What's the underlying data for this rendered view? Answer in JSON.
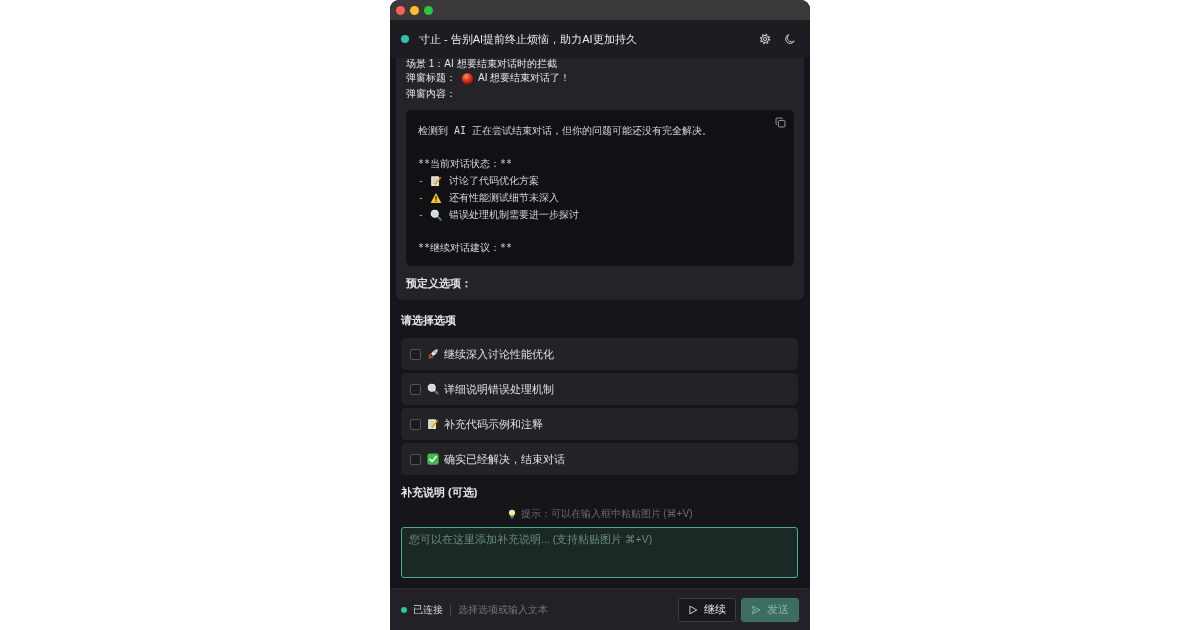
{
  "window": {
    "title": "寸止 - 告别AI提前终止烦恼，助力AI更加持久"
  },
  "popup": {
    "scene": "场景 1：AI 想要结束对话时的拦截",
    "title_label": "弹窗标题：",
    "title_value": "AI 想要结束对话了！",
    "content_label": "弹窗内容：",
    "content": {
      "paragraphs": [
        [
          {
            "kind": "plain",
            "text": "检测到 AI 正在尝试结束对话，但你的问题可能还没有完全解决。"
          }
        ],
        [
          {
            "kind": "plain",
            "text": "**当前对话状态：**"
          },
          {
            "kind": "note",
            "bullet": "-",
            "text": "讨论了代码优化方案"
          },
          {
            "kind": "warning",
            "bullet": "-",
            "text": "还有性能测试细节未深入"
          },
          {
            "kind": "search",
            "bullet": "-",
            "text": "错误处理机制需要进一步探讨"
          }
        ],
        [
          {
            "kind": "plain",
            "text": "**继续对话建议：**"
          }
        ]
      ]
    },
    "options_label": "预定义选项："
  },
  "options": {
    "heading": "请选择选项",
    "items": [
      {
        "kind": "rocket",
        "label": "继续深入讨论性能优化",
        "checked": false
      },
      {
        "kind": "search",
        "label": "详细说明错误处理机制",
        "checked": false
      },
      {
        "kind": "note",
        "label": "补充代码示例和注释",
        "checked": false
      },
      {
        "kind": "check",
        "label": "确实已经解决，结束对话",
        "checked": false
      }
    ]
  },
  "note": {
    "heading": "补充说明 (可选)",
    "tip": "提示：可以在输入框中粘贴图片 (⌘+V)",
    "placeholder": "您可以在这里添加补充说明... (支持粘贴图片 ⌘+V)"
  },
  "status_bar": {
    "status": "已连接",
    "hint": "选择选项或输入文本",
    "buttons": [
      {
        "kind": "continue",
        "label": "继续",
        "disabled": false
      },
      {
        "kind": "send",
        "label": "发送",
        "disabled": true
      }
    ]
  }
}
